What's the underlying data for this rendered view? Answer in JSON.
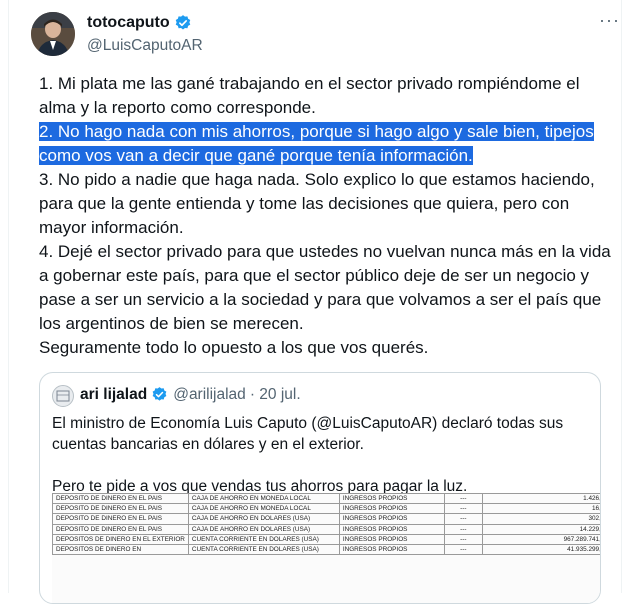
{
  "author": {
    "name": "totocaputo",
    "handle": "@LuisCaputoAR",
    "verified_icon": "verified-badge-icon",
    "more_label": "···"
  },
  "tweet": {
    "p1": "1. Mi plata me las gané trabajando en el sector privado rompiéndome el alma y la reporto como corresponde.",
    "p2": "2. No hago nada con mis ahorros, porque si hago algo y sale bien, tipejos como vos van a decir que gané porque tenía información.",
    "p3": "3. No pido a nadie que haga nada. Solo explico lo que estamos haciendo, para que la gente entienda y tome las decisiones que quiera, pero con mayor información.",
    "p4": "4. Dejé el sector privado para que ustedes no vuelvan nunca más en la vida a gobernar este país, para que el sector público deje de ser un negocio y pase a ser un servicio a la sociedad y para que volvamos a ser el país que los argentinos de bien se merecen.",
    "p5": "Seguramente todo lo opuesto a los que vos querés."
  },
  "colors": {
    "highlight": "#1d6ae0",
    "verified": "#1d9bf0",
    "secondary_text": "#536471"
  },
  "quote": {
    "name": "ari lijalad",
    "handle": "@arilijalad",
    "date": "· 20 jul.",
    "text1": "El ministro de Economía Luis Caputo (@LuisCaputoAR) declaró todas sus cuentas bancarias en dólares y en el exterior.",
    "text2": "Pero te pide a vos que vendas tus ahorros para pagar la luz.",
    "document": {
      "rows": [
        [
          "DEPOSITO DE DINERO EN EL PAIS",
          "CAJA DE AHORRO EN MONEDA LOCAL",
          "INGRESOS PROPIOS",
          "---",
          "1.426,55"
        ],
        [
          "DEPOSITO DE DINERO EN EL PAIS",
          "CAJA DE AHORRO EN MONEDA LOCAL",
          "INGRESOS PROPIOS",
          "---",
          "16,55"
        ],
        [
          "DEPOSITO DE DINERO EN EL PAIS",
          "CAJA DE AHORRO EN DOLARES (USA)",
          "INGRESOS PROPIOS",
          "---",
          "302,16"
        ],
        [
          "DEPOSITO DE DINERO EN EL PAIS",
          "CAJA DE AHORRO EN DOLARES (USA)",
          "INGRESOS PROPIOS",
          "---",
          "14.229,00"
        ],
        [
          "DEPOSITOS DE DINERO EN EL EXTERIOR",
          "CUENTA CORRIENTE EN DOLARES (USA)",
          "INGRESOS PROPIOS",
          "---",
          "967.289.741,76"
        ],
        [
          "DEPOSITOS DE DINERO EN",
          "CUENTA CORRIENTE EN DOLARES (USA)",
          "INGRESOS PROPIOS",
          "---",
          "41.935.299,53"
        ]
      ]
    }
  }
}
